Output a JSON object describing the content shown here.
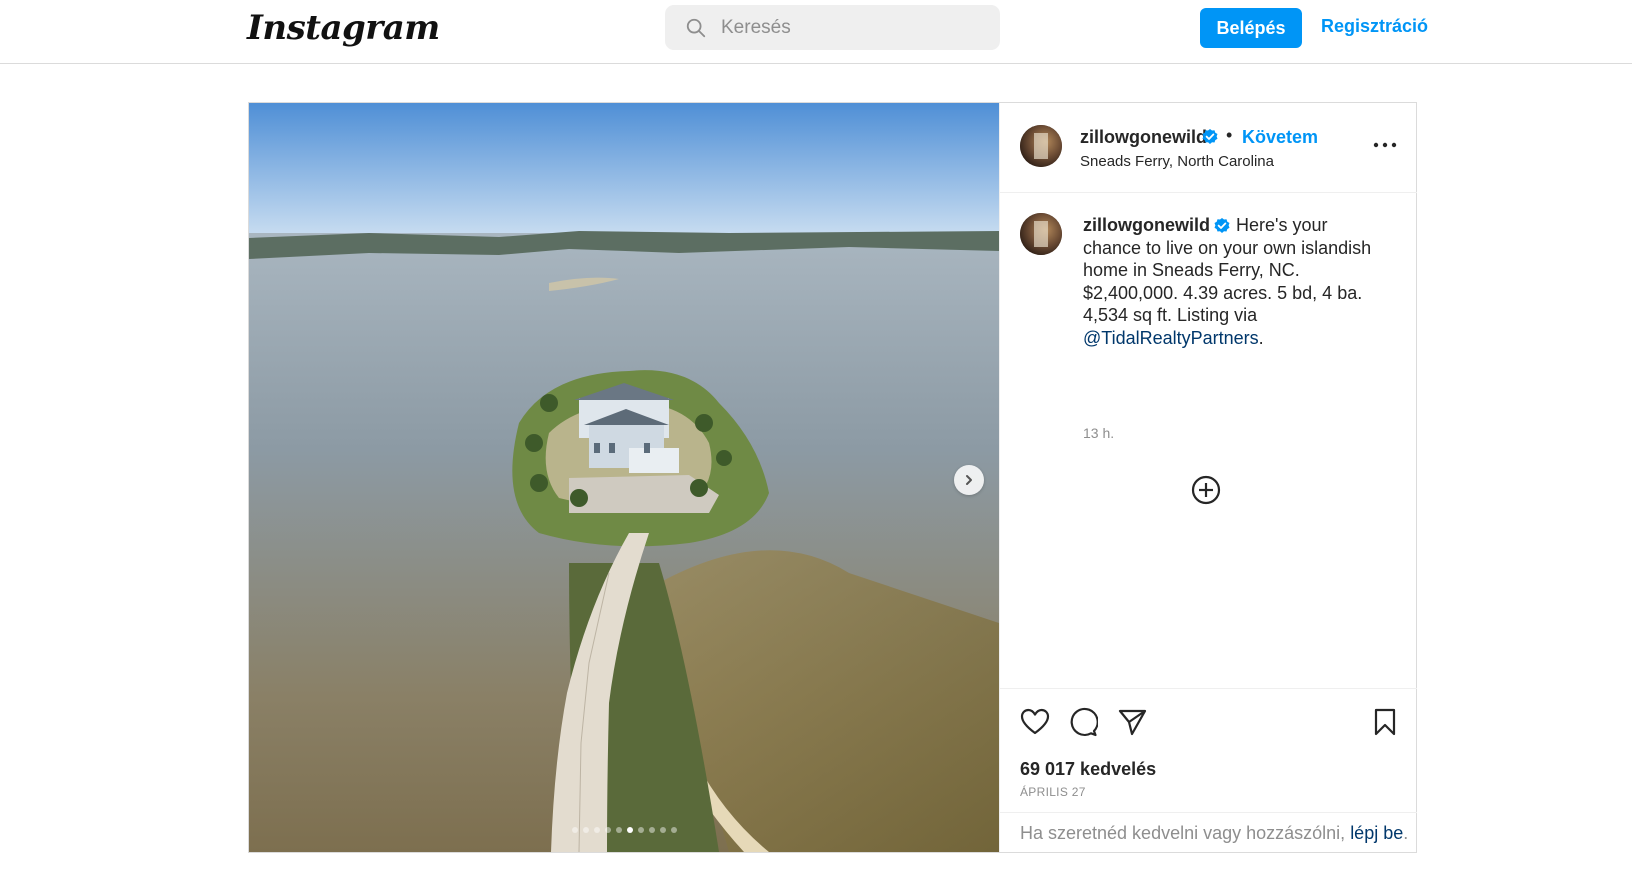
{
  "nav": {
    "logo": "Instagram",
    "search_placeholder": "Keresés",
    "login_label": "Belépés",
    "signup_label": "Regisztráció"
  },
  "post": {
    "header": {
      "username": "zillowgonewild",
      "follow_label": "Követem",
      "separator": "•",
      "location": "Sneads Ferry, North Carolina"
    },
    "caption": {
      "username": "zillowgonewild",
      "text": " Here's your chance to live on your own islandish home in Sneads Ferry, NC. $2,400,000. 4.39 acres. 5 bd, 4 ba. 4,534 sq ft. Listing via ",
      "mention": "@TidalRealtyPartners",
      "end": ".",
      "timestamp": "13 h."
    },
    "likes": "69 017 kedvelés",
    "date": "ÁPRILIS 27",
    "login_prompt": {
      "text": "Ha szeretnéd kedvelni vagy hozzászólni, ",
      "link": "lépj be",
      "end": "."
    },
    "carousel": {
      "total": 10,
      "active_index": 5
    }
  },
  "colors": {
    "accent": "#0095f6",
    "link_dark": "#00376b",
    "muted": "#8e8e8e"
  },
  "icons": [
    "search-icon",
    "verified-badge-icon",
    "more-options-icon",
    "add-comment-icon",
    "heart-icon",
    "comment-icon",
    "share-icon",
    "bookmark-icon",
    "chevron-right-icon"
  ]
}
